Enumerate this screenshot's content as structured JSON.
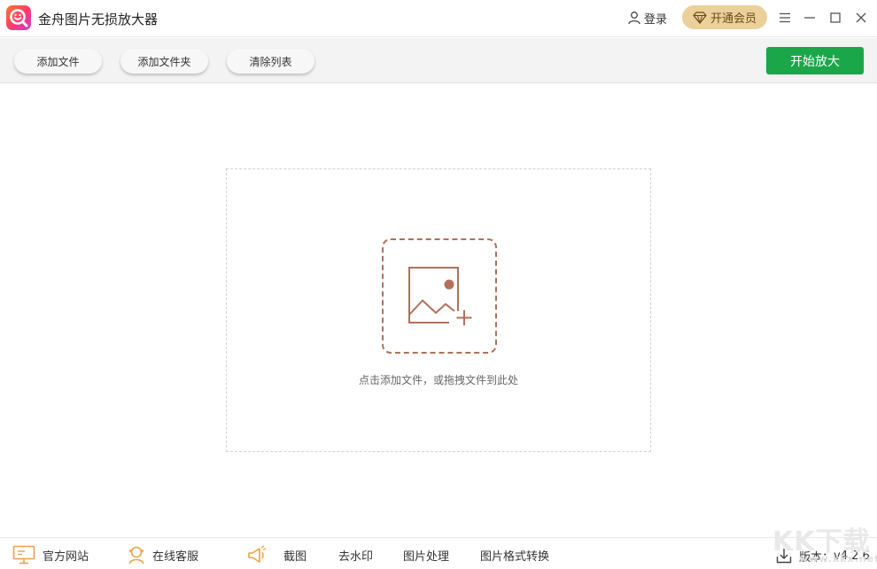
{
  "app": {
    "title": "金舟图片无损放大器"
  },
  "header": {
    "login_label": "登录",
    "vip_label": "开通会员"
  },
  "toolbar": {
    "add_file_label": "添加文件",
    "add_folder_label": "添加文件夹",
    "clear_list_label": "清除列表",
    "start_label": "开始放大"
  },
  "dropzone": {
    "hint": "点击添加文件，或拖拽文件到此处"
  },
  "footer": {
    "website_label": "官方网站",
    "support_label": "在线客服",
    "screenshot_label": "截图",
    "watermark_label": "去水印",
    "image_process_label": "图片处理",
    "format_convert_label": "图片格式转换",
    "version_label": "版本：",
    "version_value": "v4.2.6"
  },
  "watermark": {
    "main": "KK下载",
    "sub": "www.kkx.net"
  },
  "colors": {
    "accent_green": "#1aa649",
    "vip_gold": "#ecd09a",
    "drop_icon": "#b0705a",
    "footer_icon": "#e8a24a"
  }
}
